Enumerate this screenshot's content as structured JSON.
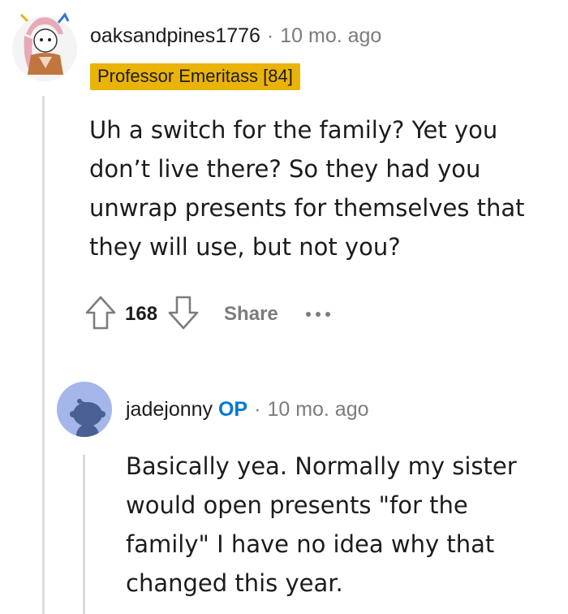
{
  "comments": [
    {
      "username": "oaksandpines1776",
      "timestamp": "10 mo. ago",
      "flair": "Professor Emeritass [84]",
      "body": "Uh a switch for the family? Yet you\ndon’t live there? So they had you\nunwrap presents for themselves that\nthey will use, but not you?",
      "votes": "168",
      "share_label": "Share"
    },
    {
      "username": "jadejonny",
      "op_badge": "OP",
      "timestamp": "10 mo. ago",
      "body": "Basically yea. Normally my sister\nwould open presents \"for the\nfamily\" I have no idea why that\nchanged this year."
    }
  ],
  "separator": "·",
  "colors": {
    "flair_bg": "#e9b308",
    "op_blue": "#0079d3",
    "meta_gray": "#7c7c7c",
    "avatar_bg": "#a4b6ea"
  }
}
